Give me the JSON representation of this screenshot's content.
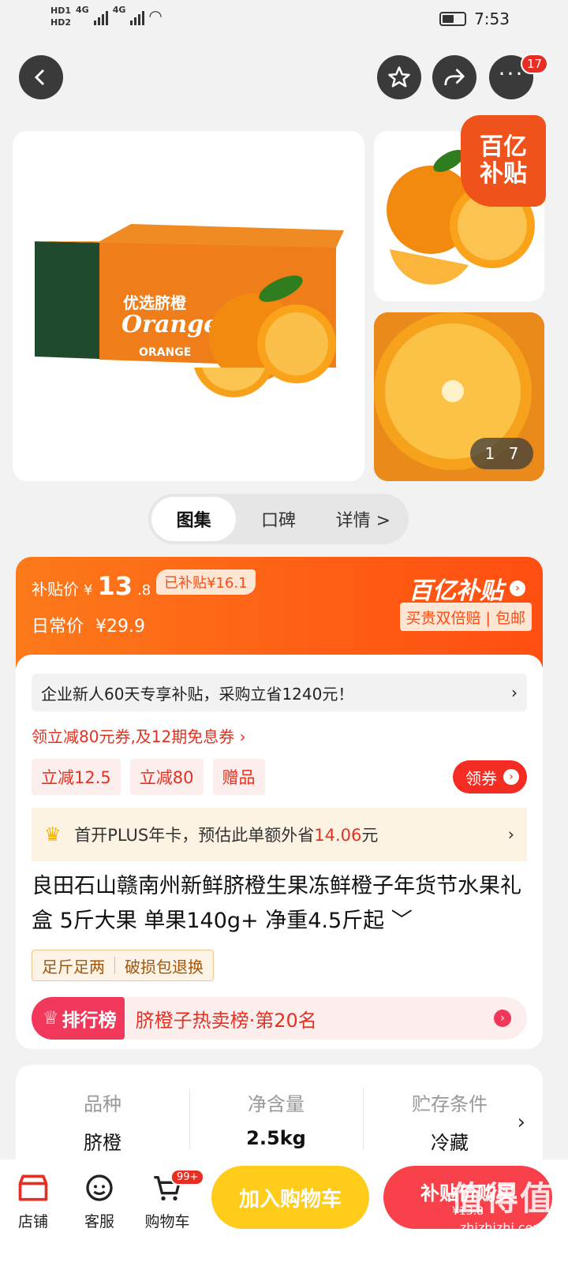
{
  "status": {
    "hd1": "HD1",
    "hd2": "HD2",
    "net1": "4G",
    "net2": "4G",
    "time": "7:53"
  },
  "header": {
    "menu_badge": "17"
  },
  "gallery": {
    "box_text_cn": "优选脐橙",
    "box_text_en": "Orange",
    "box_side": "ORANGE",
    "corner_line1": "百亿",
    "corner_line2": "补贴",
    "counter_current": "1",
    "counter_total": "7"
  },
  "tabs": [
    "图集",
    "口碑",
    "详情 >"
  ],
  "price": {
    "subsidy_label": "补贴价",
    "currency": "¥",
    "price_int": "13",
    "price_dec": ".8",
    "subsidized": "已补贴¥16.1",
    "daily_label": "日常价",
    "daily_price": "¥29.9",
    "brand": "百亿补贴",
    "brand_sub": "买贵双倍赔 | 包邮"
  },
  "promo": {
    "enterprise": "企业新人60天专享补贴，采购立省1240元！",
    "coupon_link": "领立减80元券,及12期免息券 ›",
    "chips": [
      "立减12.5",
      "立减80",
      "赠品"
    ],
    "get_coupon": "领券",
    "plus_text_before": "首开PLUS年卡，预估此单额外省",
    "plus_highlight": "14.06",
    "plus_text_after": "元"
  },
  "product": {
    "title": "良田石山赣南州新鲜脐橙生果冻鲜橙子年货节水果礼盒 5斤大果 单果140g+ 净重4.5斤起 ﹀",
    "tags": [
      "足斤足两",
      "破损包退换"
    ],
    "rank_badge": "排行榜",
    "rank_text": "脐橙子热卖榜·第20名"
  },
  "specs": [
    {
      "key": "品种",
      "value": "脐橙"
    },
    {
      "key": "净含量",
      "value": "2.5kg"
    },
    {
      "key": "贮存条件",
      "value": "冷藏"
    }
  ],
  "bottom": {
    "store": "店铺",
    "service": "客服",
    "cart": "购物车",
    "cart_badge": "99+",
    "add_cart": "加入购物车",
    "buy": "补贴价购买",
    "buy_price": "¥13.8"
  },
  "watermark": {
    "line1": "值得值",
    "line2": "zhizhizhi.com"
  },
  "colors": {
    "accent": "#ff5d14",
    "red": "#e43222",
    "yellow": "#ffcc1a",
    "buy": "#f8414a"
  }
}
